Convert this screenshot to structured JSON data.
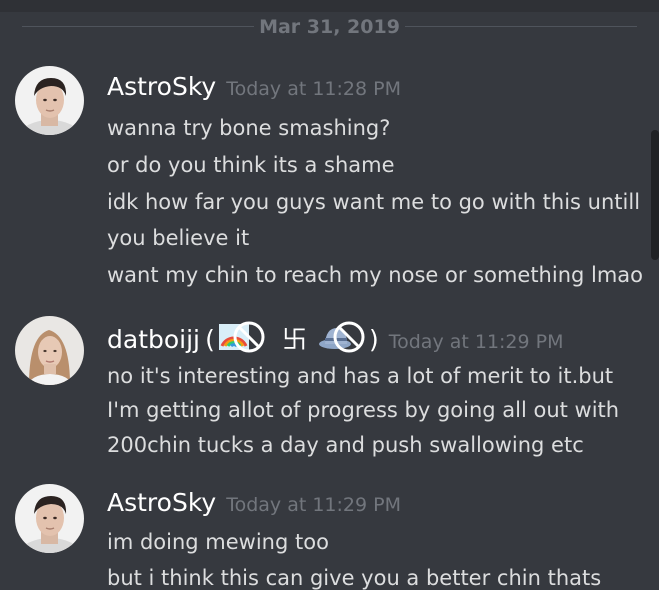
{
  "date_divider": "Mar 31, 2019",
  "messages": [
    {
      "username": "AstroSky",
      "timestamp": "Today at 11:28 PM",
      "lines": [
        "wanna try bone smashing?",
        "or do you think its a shame",
        "idk how far you guys want me to go with this untill",
        "you believe it",
        "want my chin to reach my nose or something lmao"
      ]
    },
    {
      "username": "datboijj",
      "name_open": "(",
      "name_symbol": "卐",
      "name_close": ")",
      "timestamp": "Today at 11:29 PM",
      "lines": [
        "no it's interesting and has a lot of merit to it.but",
        "I'm getting allot of progress by going all out with",
        "200chin tucks a day and push swallowing etc"
      ]
    },
    {
      "username": "AstroSky",
      "timestamp": "Today at 11:29 PM",
      "lines": [
        "im doing mewing too",
        "but i think this can give you a better chin thats"
      ]
    }
  ],
  "icons": {
    "rainbow_no": "rainbow-prohibited-icon",
    "hat_no": "hat-prohibited-icon"
  },
  "colors": {
    "background": "#36393f",
    "text": "#dcddde",
    "username": "#ffffff",
    "timestamp": "#72767d"
  }
}
